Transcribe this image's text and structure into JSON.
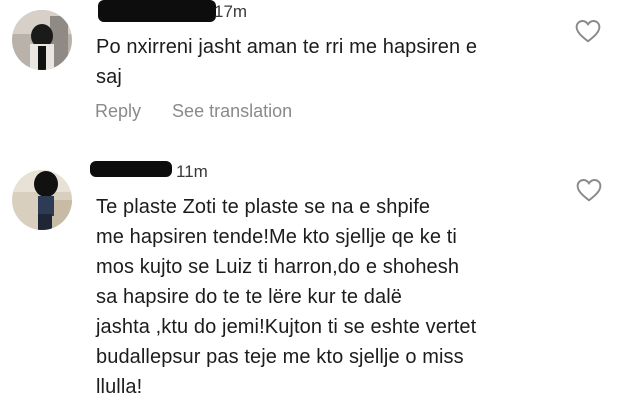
{
  "comments": [
    {
      "timestamp": "17m",
      "lines": [
        "Po nxirreni jasht aman te rri me hapsiren e",
        "saj"
      ],
      "actions": {
        "reply": "Reply",
        "translate": "See translation"
      }
    },
    {
      "timestamp": "11m",
      "lines": [
        "Te plaste Zoti te plaste se na e shpife",
        "me hapsiren tende!Me kto sjellje qe ke ti",
        "mos kujto se Luiz ti harron,do e shohesh",
        "sa hapsire do te te lëre kur te dalë",
        "jashta ,ktu do jemi!Kujton ti se eshte vertet",
        "budallepsur pas teje me kto sjellje o miss",
        "llulla!"
      ]
    }
  ],
  "icons": {
    "like": "heart-outline-icon",
    "avatar": "profile-avatar"
  }
}
